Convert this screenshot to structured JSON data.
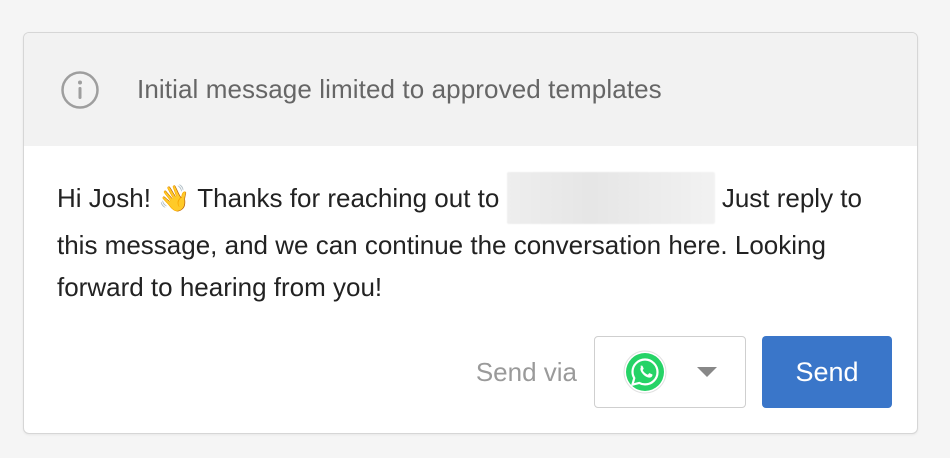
{
  "notice": {
    "icon": "info-circle-icon",
    "text": "Initial message limited to approved templates"
  },
  "message": {
    "before": "Hi Josh! 👋 Thanks for reaching out to",
    "redacted": "",
    "after": "Just reply to this message, and we can continue the conversation here. Looking forward to hearing from you!"
  },
  "footer": {
    "send_via_label": "Send via",
    "channel": {
      "icon": "whatsapp-icon",
      "icon_color": "#25d366"
    },
    "send_label": "Send",
    "send_color": "#3a76c9"
  }
}
